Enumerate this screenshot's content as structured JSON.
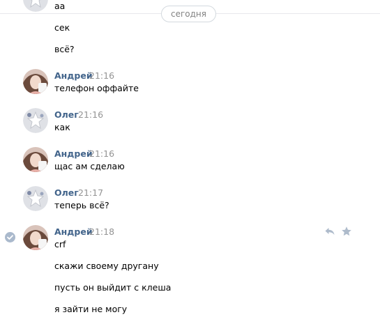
{
  "date_divider": "сегодня",
  "earlier_messages": [
    "аа",
    "сек",
    "всё?"
  ],
  "messages": [
    {
      "author": "Андрей",
      "time": "21:16",
      "lines": [
        "телефон оффайте"
      ]
    },
    {
      "author": "Олег",
      "time": "21:16",
      "lines": [
        "как"
      ]
    },
    {
      "author": "Андрей",
      "time": "21:16",
      "lines": [
        "щас ам сделаю"
      ]
    },
    {
      "author": "Олег",
      "time": "21:17",
      "lines": [
        "теперь всё?"
      ]
    },
    {
      "author": "Андрей",
      "time": "21:18",
      "lines": [
        "crf",
        "скажи своему другану",
        "пусть он выйдит с клеша",
        "я зайти не могу"
      ]
    }
  ],
  "icons": {
    "selected_check": "check-icon",
    "reply": "reply-icon",
    "favorite": "star-icon"
  },
  "colors": {
    "author_name": "#42648b",
    "timestamp": "#939393",
    "action_icons": "#aebbcb"
  }
}
